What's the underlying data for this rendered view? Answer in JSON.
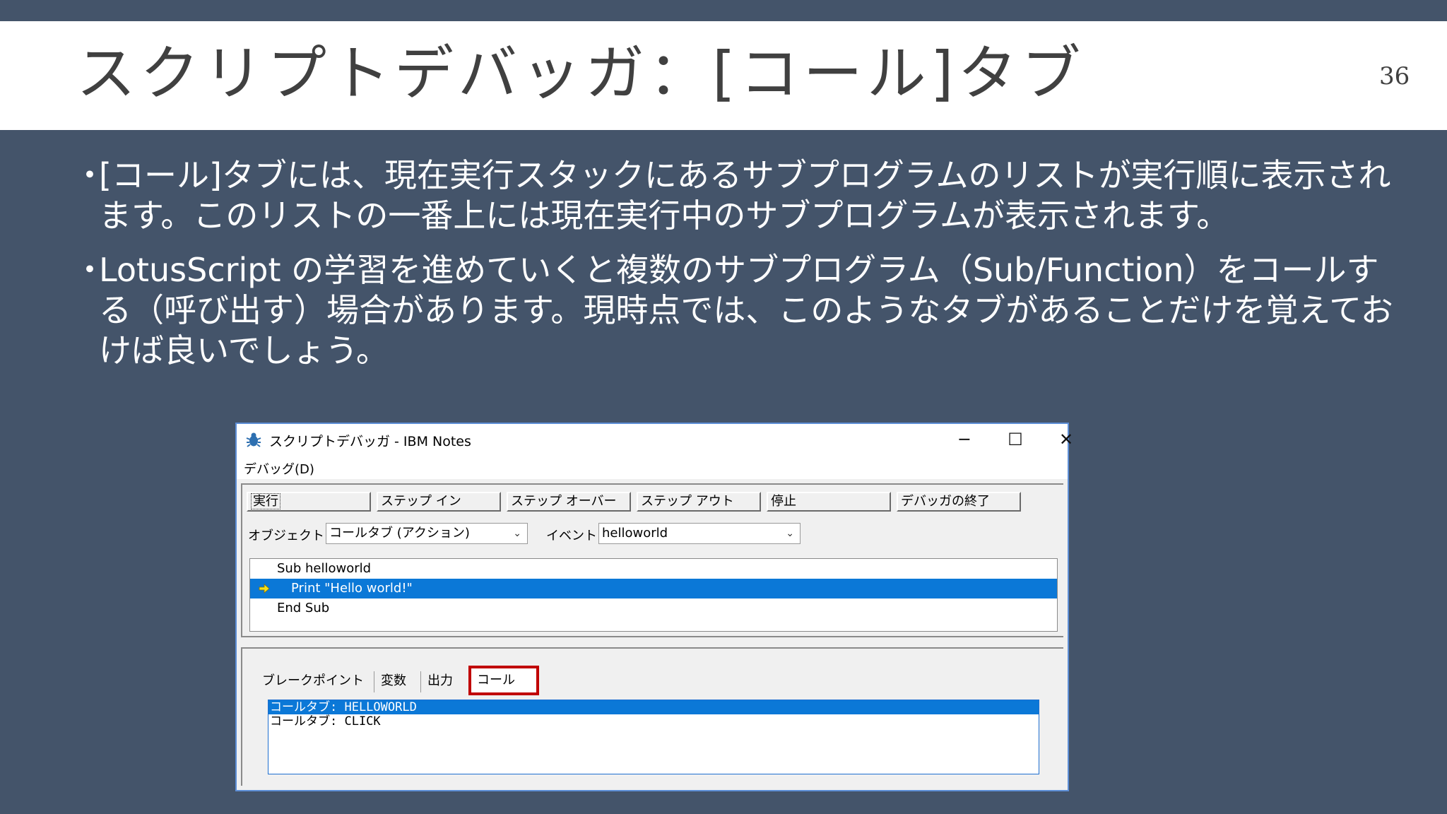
{
  "slide": {
    "title": "スクリプトデバッガ：[コール]タブ",
    "number": "36",
    "bullet_mark": "・",
    "bullets": [
      "[コール]タブには、現在実行スタックにあるサブプログラムのリストが実行順に表示されます。このリストの一番上には現在実行中のサブプログラムが表示されます。",
      "LotusScript の学習を進めていくと複数のサブプログラム（Sub/Function）をコールする（呼び出す）場合があります。現時点では、このようなタブがあることだけを覚えておけば良いでしょう。"
    ]
  },
  "window": {
    "title": "スクリプトデバッガ - IBM Notes",
    "controls": {
      "minimize": "─",
      "maximize": "☐",
      "close": "✕"
    },
    "menu": "デバッグ(D)",
    "toolbar": [
      "実行",
      "ステップ イン",
      "ステップ オーバー",
      "ステップ アウト",
      "停止",
      "デバッガの終了"
    ],
    "object_label": "オブジェクト:",
    "object_value": "コールタブ (アクション)",
    "event_label": "イベント:",
    "event_value": "helloworld",
    "code_lines": [
      "Sub helloworld",
      "Print \"Hello world!\"",
      "End Sub"
    ],
    "tabs": [
      "ブレークポイント",
      "変数",
      "出力",
      "コール"
    ],
    "call_stack": [
      "コールタブ: HELLOWORLD",
      "コールタブ: CLICK"
    ]
  },
  "colors": {
    "background": "#44546a",
    "selection": "#0b78d7",
    "highlight_box": "#c00000"
  }
}
